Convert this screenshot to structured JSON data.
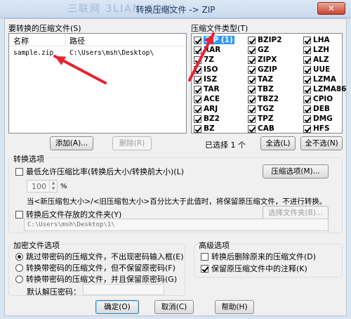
{
  "window": {
    "title": "转换压缩文件 -> ZIP",
    "close_glyph": "✕"
  },
  "watermark": "三联网 3LIAN.COM",
  "files": {
    "label": "要转换的压缩文件(S)",
    "columns": [
      "名称",
      "路径"
    ],
    "rows": [
      {
        "name": "sample.zip",
        "path": "C:\\Users\\msh\\Desktop\\"
      }
    ],
    "add_label": "添加(A)...",
    "remove_label": "删除(R)"
  },
  "types": {
    "label": "压缩文件类型(T)",
    "col1": [
      "ZIP (1)",
      "RAR",
      "7Z",
      "ISO",
      "ISZ",
      "TAR",
      "ACE",
      "ARJ",
      "BZ2",
      "BZ"
    ],
    "col2": [
      "BZIP2",
      "GZ",
      "ZIPX",
      "GZIP",
      "TAZ",
      "TBZ",
      "TBZ2",
      "TGZ",
      "TPZ",
      "CAB"
    ],
    "col3": [
      "LHA",
      "LZH",
      "ALZ",
      "UUE",
      "LZMA",
      "LZMA86",
      "CPIO",
      "DEB",
      "DMG",
      "HFS"
    ],
    "selected_text": "已选择 1 个",
    "select_all_label": "全选(L)",
    "select_none_label": "全不选(N)"
  },
  "convert": {
    "label": "转换选项",
    "min_ratio_label": "最低允许压缩比率(转换后大小/转换前大小)(L)",
    "compress_options_label": "压缩选项(M)...",
    "ratio_value": "100",
    "percent": "%",
    "note": "当<新压缩包大小>/<旧压缩包大小>百分比大于此值时，将保留原压缩文件，不进行转换。",
    "save_folder_label": "转换后文件存放的文件夹(Y)",
    "choose_folder_label": "选择文件夹(B)...",
    "folder_path": "C:\\Users\\msh\\Desktop\\1\\"
  },
  "encrypt": {
    "label": "加密文件选项",
    "options": [
      "跳过带密码的压缩文件，不出现密码输入框(E)",
      "转换带密码的压缩文件，但不保留原密码(F)",
      "转换带密码的压缩文件，并且保留原密码(G)"
    ],
    "default_pw_label": "默认解压密码："
  },
  "advanced": {
    "label": "高级选项",
    "delete_original_label": "转换后删除原来的压缩文件(D)",
    "keep_comment_label": "保留原压缩文件中的注释(K)"
  },
  "buttons": {
    "ok": "确定(O)",
    "cancel": "取消(C)",
    "help": "帮助(H)"
  },
  "arrow_color": "#e8212e"
}
